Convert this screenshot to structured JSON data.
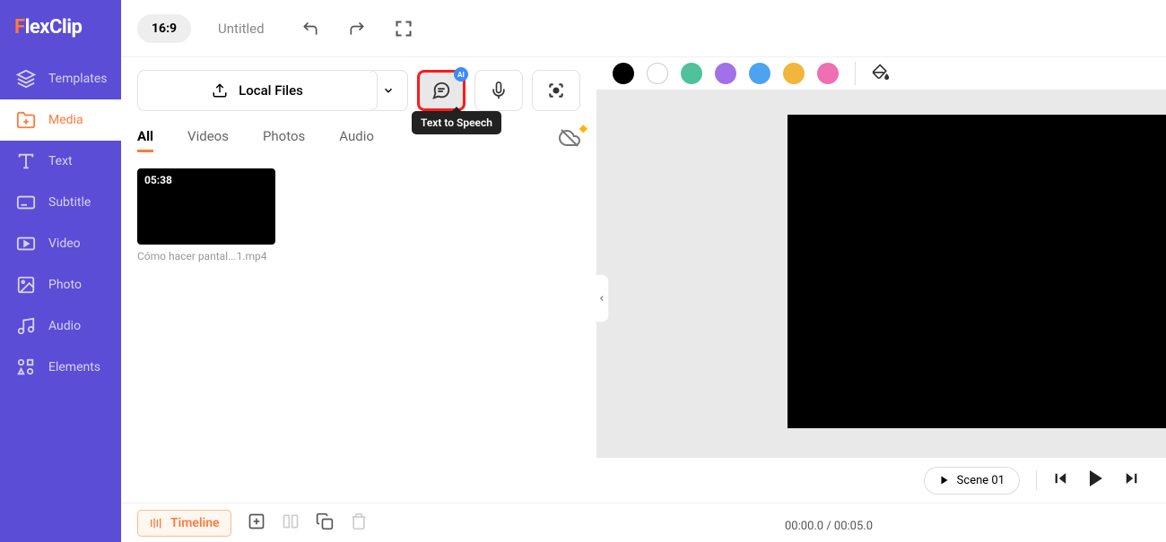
{
  "logo": {
    "prefix": "F",
    "rest": "lexClip"
  },
  "topbar": {
    "aspect": "16:9",
    "title": "Untitled"
  },
  "sidebar": {
    "items": [
      {
        "label": "Templates"
      },
      {
        "label": "Media"
      },
      {
        "label": "Text"
      },
      {
        "label": "Subtitle"
      },
      {
        "label": "Video"
      },
      {
        "label": "Photo"
      },
      {
        "label": "Audio"
      },
      {
        "label": "Elements"
      }
    ]
  },
  "upload": {
    "label": "Local Files"
  },
  "tts": {
    "badge": "AI",
    "tooltip": "Text to Speech"
  },
  "tabs": [
    {
      "label": "All"
    },
    {
      "label": "Videos"
    },
    {
      "label": "Photos"
    },
    {
      "label": "Audio"
    }
  ],
  "media": [
    {
      "duration": "05:38",
      "filename": "Cómo hacer pantal...1.mp4"
    }
  ],
  "colors": [
    "#000000",
    "#ffffff",
    "#4ec29a",
    "#a271e8",
    "#4da3f0",
    "#f2b63c",
    "#ef6fb0"
  ],
  "scene": {
    "label": "Scene 01"
  },
  "timeline": {
    "label": "Timeline"
  },
  "time": {
    "display": "00:00.0 / 00:05.0"
  }
}
